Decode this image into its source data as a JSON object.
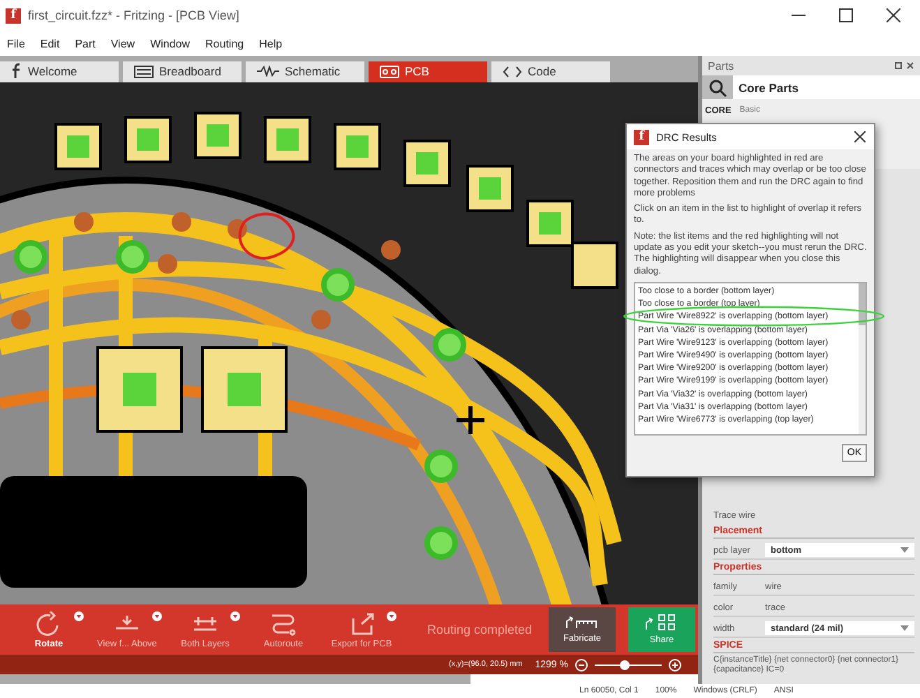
{
  "window": {
    "logo": "f",
    "title": "first_circuit.fzz* - Fritzing - [PCB View]"
  },
  "menu": [
    "File",
    "Edit",
    "Part",
    "View",
    "Window",
    "Routing",
    "Help"
  ],
  "tabs": [
    {
      "label": "Welcome",
      "kind": "welcome",
      "selected": false
    },
    {
      "label": "Breadboard",
      "kind": "breadboard",
      "selected": false
    },
    {
      "label": "Schematic",
      "kind": "schematic",
      "selected": false
    },
    {
      "label": "PCB",
      "kind": "pcb",
      "selected": true
    },
    {
      "label": "Code",
      "kind": "code",
      "selected": false
    }
  ],
  "parts": {
    "title": "Parts",
    "bin": "Core Parts",
    "bin_tab": "CORE",
    "section": "Basic"
  },
  "inspector": {
    "title": "Trace wire",
    "sections": [
      {
        "heading": "Placement",
        "rows": [
          {
            "label": "pcb layer",
            "value": "bottom",
            "kind": "dropdown"
          }
        ]
      },
      {
        "heading": "Properties",
        "rows": [
          {
            "label": "family",
            "value": "wire",
            "kind": "text"
          },
          {
            "label": "color",
            "value": "trace",
            "kind": "text"
          },
          {
            "label": "width",
            "value": "standard (24 mil)",
            "kind": "dropdown"
          }
        ]
      },
      {
        "heading": "SPICE",
        "rows": [
          {
            "label": "",
            "value": "C{instanceTitle} {net connector0} {net connector1} {capacitance} IC=0",
            "kind": "note"
          }
        ]
      }
    ]
  },
  "dialog": {
    "logo": "f",
    "title": "DRC Results",
    "paragraphs": [
      "The areas on your board highlighted in red are connectors and traces which may overlap or be too close together. Reposition them and run the DRC again to find more problems",
      "Click on an item in the list to highlight of overlap it refers to.",
      "Note: the list items and the red highlighting will not update as you edit your sketch--you must rerun the DRC. The highlighting will disappear when you close this dialog."
    ],
    "items": [
      "Too close to a border (bottom layer)",
      "Too close to a border (top layer)",
      "Part Wire 'Wire8922' is overlapping (bottom layer)",
      "Part Via 'Via26' is overlapping (bottom layer)",
      "Part Wire 'Wire9123' is overlapping (bottom layer)",
      "Part Wire 'Wire9490' is overlapping (bottom layer)",
      "Part Wire 'Wire9200' is overlapping (bottom layer)",
      "Part Wire 'Wire9199' is overlapping (bottom layer)",
      "Part Via 'Via32' is overlapping (bottom layer)",
      "Part Via 'Via31' is overlapping (bottom layer)",
      "Part Wire 'Wire6773' is overlapping (top layer)"
    ],
    "ok": "OK"
  },
  "toolbar": {
    "tools": [
      {
        "label": "Rotate",
        "kind": "rotate",
        "dropdown": true
      },
      {
        "label": "View f... Above",
        "kind": "view",
        "dropdown": true
      },
      {
        "label": "Both Layers",
        "kind": "layers",
        "dropdown": true
      },
      {
        "label": "Autoroute",
        "kind": "autoroute",
        "dropdown": false
      },
      {
        "label": "Export for PCB",
        "kind": "export",
        "dropdown": true
      }
    ],
    "status": "Routing completed",
    "fabricate": "Fabricate",
    "share": "Share"
  },
  "zoombar": {
    "coords": "(x,y)=(96.0, 20.5) mm",
    "zoom": "1299 %",
    "level": 0.43
  },
  "status_bar": [
    "Ln 60050, Col 1",
    "100%",
    "Windows (CRLF)",
    "ANSI"
  ]
}
